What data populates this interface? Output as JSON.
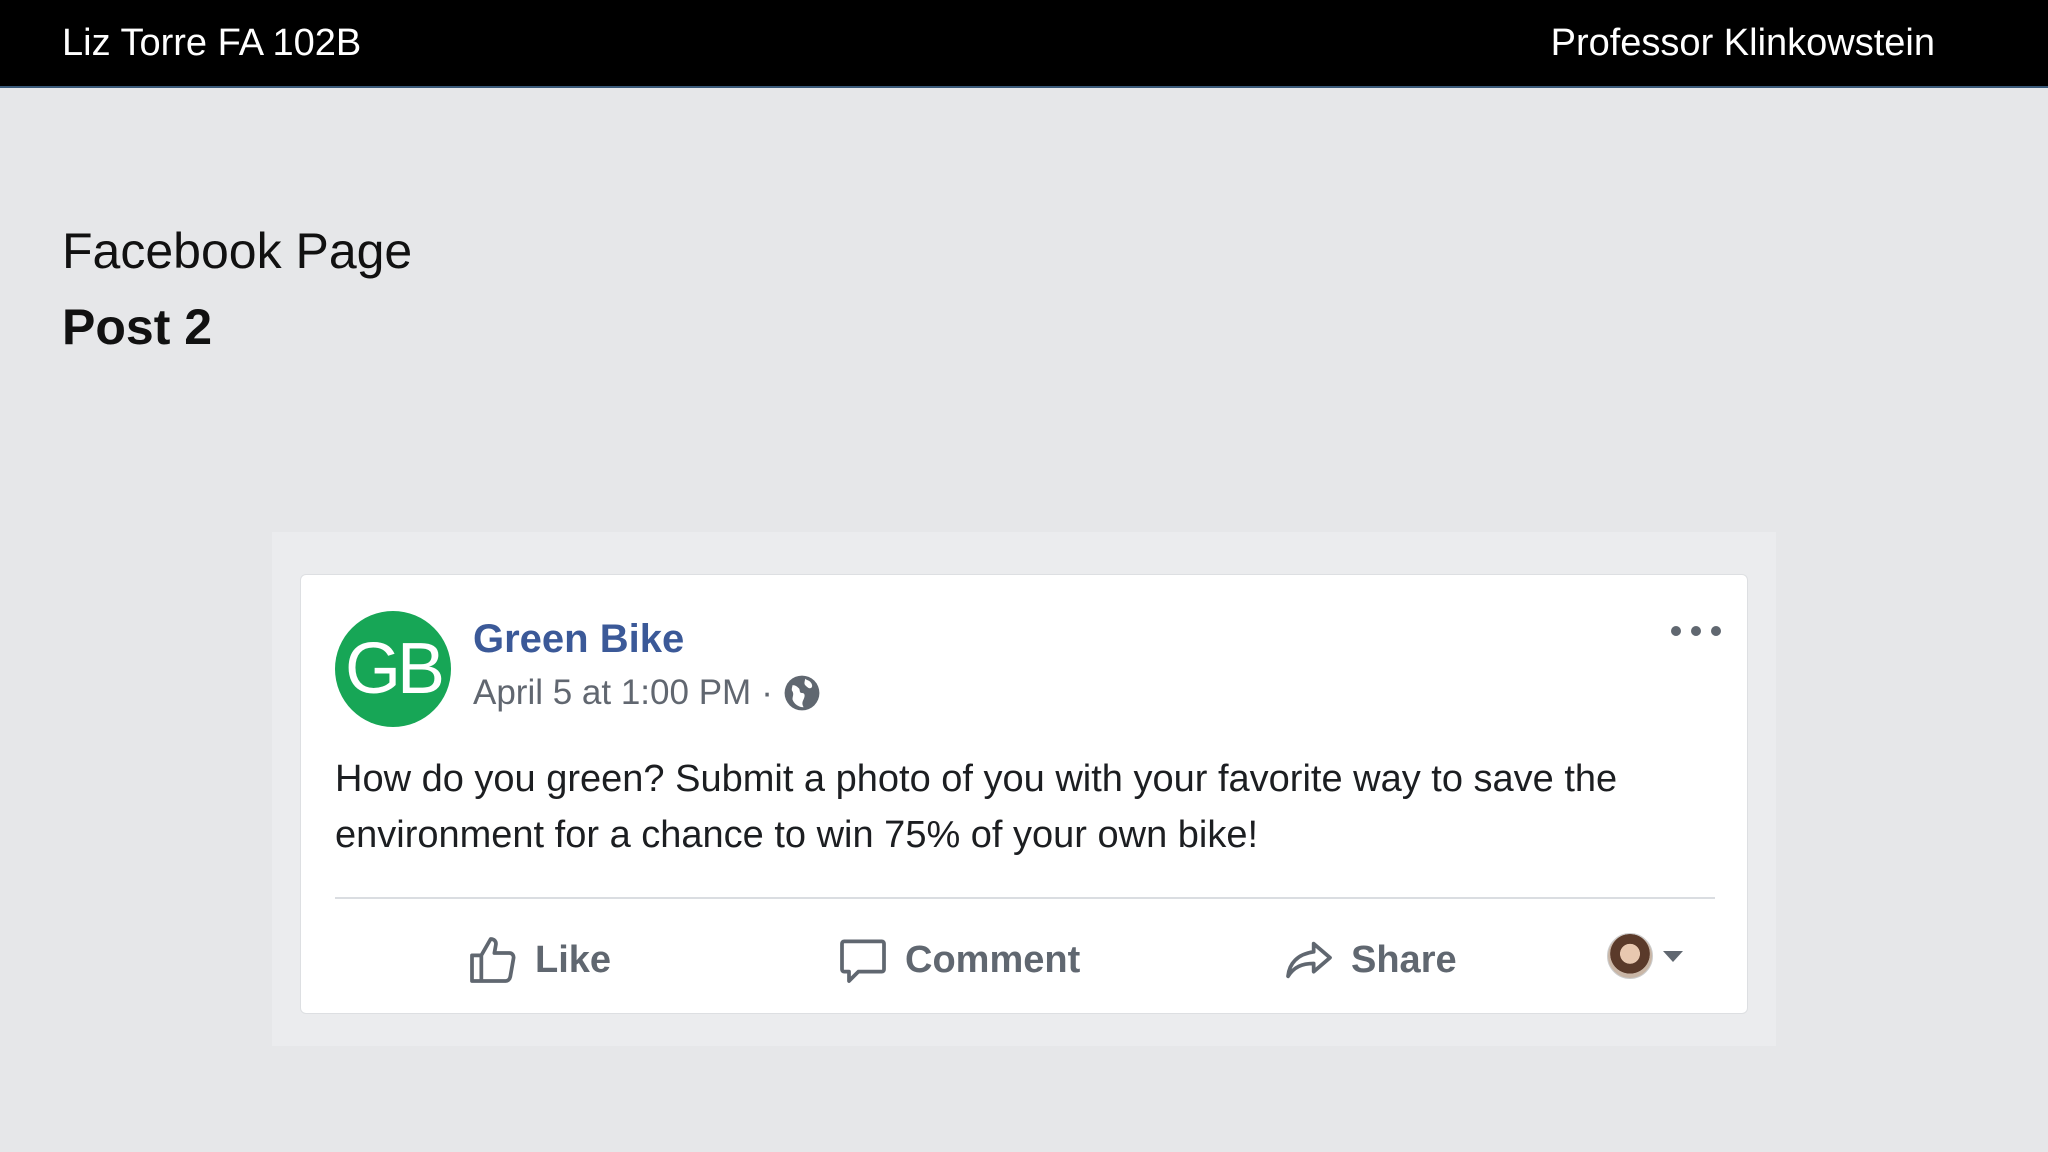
{
  "header": {
    "left_text": "Liz Torre FA 102B",
    "right_text": "Professor Klinkowstein"
  },
  "slide": {
    "title": "Facebook Page",
    "subtitle": "Post 2"
  },
  "post": {
    "avatar_initials": "GB",
    "avatar_color": "#17a656",
    "page_name": "Green Bike",
    "timestamp": "April 5 at 1:00 PM",
    "separator": "·",
    "privacy_icon": "globe-icon",
    "text": "How do you green? Submit a photo of you with your favorite way to save the environment for a chance to win 75% of your own bike!",
    "actions": {
      "like": "Like",
      "comment": "Comment",
      "share": "Share"
    },
    "name_color": "#3b5998"
  }
}
